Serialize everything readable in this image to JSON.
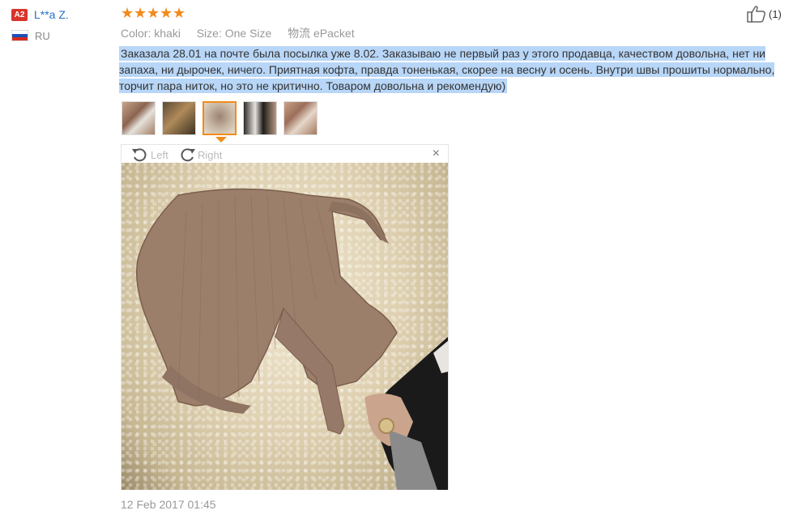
{
  "user": {
    "badge": "A2",
    "name": "L**a Z.",
    "country": "RU"
  },
  "rating": {
    "stars": 5,
    "star_glyph": "★",
    "color": "#f28b1a"
  },
  "meta": {
    "color_label": "Color:",
    "color_value": "khaki",
    "size_label": "Size:",
    "size_value": "One Size",
    "shipping_label": "物流",
    "shipping_value": "ePacket"
  },
  "review": {
    "text": "Заказала 28.01 на почте была посылка уже 8.02. Заказываю не первый раз у этого продавца, качеством довольна, нет ни запаха, ни дырочек, ничего. Приятная кофта, правда тоненькая, скорее на весну и осень. Внутри швы прошиты нормально, торчит пара ниток, но это не критично. Товаром довольна и рекомендую)"
  },
  "thumbnails": [
    "photo-1",
    "photo-2",
    "photo-3",
    "photo-4",
    "photo-5"
  ],
  "thumbnails_active": 3,
  "viewer": {
    "rotate_left_label": "Left",
    "rotate_right_label": "Right",
    "close_glyph": "×"
  },
  "date": "12 Feb 2017 01:45",
  "like": {
    "count": "(1)",
    "icon": "thumbs-up-icon"
  },
  "colors": {
    "badge": "#d9342b",
    "link": "#2b6ec6",
    "highlight": "#b8d6f7",
    "accent": "#f28b1a"
  }
}
